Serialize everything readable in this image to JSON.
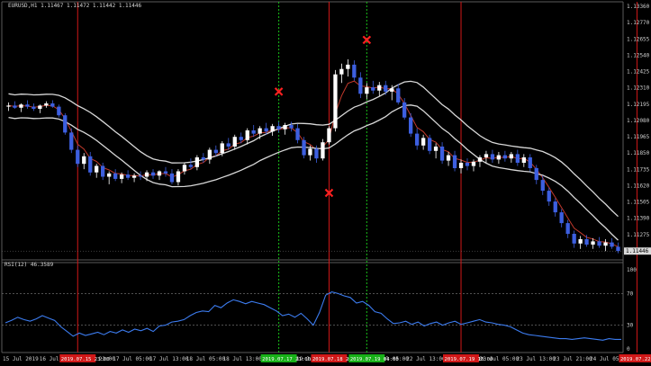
{
  "chart_data": {
    "type": "candlestick",
    "symbol_title": "EURUSD,H1  1.11467 1.11472 1.11442 1.11446",
    "price_axis_labels": [
      "1.13360",
      "1.12770",
      "1.12655",
      "1.12540",
      "1.12425",
      "1.12310",
      "1.12195",
      "1.12080",
      "1.11965",
      "1.11850",
      "1.11735",
      "1.11620",
      "1.11505",
      "1.11390",
      "1.11275",
      "1.11160"
    ],
    "current_price": "1.11446",
    "price_range": [
      1.111,
      1.1337
    ],
    "candles": [
      [
        1.1248,
        1.1252,
        1.1244,
        1.1249
      ],
      [
        1.1249,
        1.1253,
        1.1246,
        1.1247
      ],
      [
        1.1247,
        1.1251,
        1.1243,
        1.125
      ],
      [
        1.125,
        1.1254,
        1.1246,
        1.1248
      ],
      [
        1.1248,
        1.1251,
        1.1244,
        1.1246
      ],
      [
        1.1246,
        1.125,
        1.1242,
        1.1249
      ],
      [
        1.1249,
        1.1253,
        1.1247,
        1.1251
      ],
      [
        1.1251,
        1.1254,
        1.1247,
        1.1248
      ],
      [
        1.1248,
        1.125,
        1.1238,
        1.124
      ],
      [
        1.124,
        1.1242,
        1.1222,
        1.1224
      ],
      [
        1.1224,
        1.1228,
        1.1205,
        1.1208
      ],
      [
        1.1208,
        1.1212,
        1.1192,
        1.1195
      ],
      [
        1.1195,
        1.1205,
        1.119,
        1.1202
      ],
      [
        1.1202,
        1.1206,
        1.1184,
        1.1187
      ],
      [
        1.1187,
        1.1195,
        1.1182,
        1.1193
      ],
      [
        1.1193,
        1.1196,
        1.118,
        1.1183
      ],
      [
        1.1183,
        1.1188,
        1.1176,
        1.1186
      ],
      [
        1.1186,
        1.119,
        1.1179,
        1.1181
      ],
      [
        1.1181,
        1.1187,
        1.1177,
        1.1185
      ],
      [
        1.1185,
        1.1189,
        1.118,
        1.1182
      ],
      [
        1.1182,
        1.1186,
        1.1178,
        1.1184
      ],
      [
        1.1184,
        1.1188,
        1.118,
        1.1183
      ],
      [
        1.1183,
        1.1189,
        1.1179,
        1.1187
      ],
      [
        1.1187,
        1.119,
        1.1181,
        1.1184
      ],
      [
        1.1184,
        1.1189,
        1.118,
        1.1188
      ],
      [
        1.1188,
        1.1192,
        1.1183,
        1.1186
      ],
      [
        1.1186,
        1.119,
        1.1176,
        1.1178
      ],
      [
        1.1178,
        1.119,
        1.1175,
        1.1188
      ],
      [
        1.1188,
        1.1196,
        1.1185,
        1.1194
      ],
      [
        1.1194,
        1.12,
        1.119,
        1.1192
      ],
      [
        1.1192,
        1.1203,
        1.1189,
        1.1201
      ],
      [
        1.1201,
        1.1205,
        1.1196,
        1.1199
      ],
      [
        1.1199,
        1.121,
        1.1195,
        1.1208
      ],
      [
        1.1208,
        1.1212,
        1.1202,
        1.1205
      ],
      [
        1.1205,
        1.1216,
        1.1202,
        1.1214
      ],
      [
        1.1214,
        1.1219,
        1.1208,
        1.1211
      ],
      [
        1.1211,
        1.1222,
        1.1208,
        1.122
      ],
      [
        1.122,
        1.1224,
        1.1214,
        1.1217
      ],
      [
        1.1217,
        1.1228,
        1.1213,
        1.1226
      ],
      [
        1.1226,
        1.1231,
        1.122,
        1.1223
      ],
      [
        1.1223,
        1.123,
        1.1218,
        1.1228
      ],
      [
        1.1228,
        1.1233,
        1.1222,
        1.1225
      ],
      [
        1.1225,
        1.1232,
        1.1221,
        1.123
      ],
      [
        1.123,
        1.1234,
        1.1224,
        1.1227
      ],
      [
        1.1227,
        1.1233,
        1.1222,
        1.1231
      ],
      [
        1.1231,
        1.1234,
        1.1225,
        1.1228
      ],
      [
        1.1228,
        1.1232,
        1.1214,
        1.1217
      ],
      [
        1.1217,
        1.122,
        1.12,
        1.1203
      ],
      [
        1.1203,
        1.1212,
        1.1198,
        1.1209
      ],
      [
        1.1209,
        1.1212,
        1.1196,
        1.12
      ],
      [
        1.12,
        1.1218,
        1.1198,
        1.1215
      ],
      [
        1.1215,
        1.123,
        1.1213,
        1.1228
      ],
      [
        1.1228,
        1.1282,
        1.1225,
        1.1278
      ],
      [
        1.1278,
        1.1288,
        1.127,
        1.1283
      ],
      [
        1.1283,
        1.1292,
        1.1276,
        1.1287
      ],
      [
        1.1287,
        1.1291,
        1.1272,
        1.1275
      ],
      [
        1.1275,
        1.128,
        1.1256,
        1.126
      ],
      [
        1.126,
        1.127,
        1.1255,
        1.1266
      ],
      [
        1.1266,
        1.1272,
        1.126,
        1.1263
      ],
      [
        1.1263,
        1.1271,
        1.1258,
        1.1268
      ],
      [
        1.1268,
        1.1272,
        1.1259,
        1.1262
      ],
      [
        1.1262,
        1.1268,
        1.1254,
        1.1265
      ],
      [
        1.1265,
        1.1269,
        1.125,
        1.1252
      ],
      [
        1.1252,
        1.1256,
        1.1236,
        1.1238
      ],
      [
        1.1238,
        1.1242,
        1.122,
        1.1223
      ],
      [
        1.1223,
        1.1228,
        1.1208,
        1.1212
      ],
      [
        1.1212,
        1.1222,
        1.1208,
        1.1219
      ],
      [
        1.1219,
        1.1222,
        1.1204,
        1.1207
      ],
      [
        1.1207,
        1.1214,
        1.12,
        1.1211
      ],
      [
        1.1211,
        1.1215,
        1.1195,
        1.1198
      ],
      [
        1.1198,
        1.1206,
        1.1193,
        1.1203
      ],
      [
        1.1203,
        1.1207,
        1.1188,
        1.1191
      ],
      [
        1.1191,
        1.1199,
        1.1186,
        1.1196
      ],
      [
        1.1196,
        1.12,
        1.1189,
        1.1193
      ],
      [
        1.1193,
        1.1199,
        1.1188,
        1.1197
      ],
      [
        1.1197,
        1.1203,
        1.1192,
        1.1201
      ],
      [
        1.1201,
        1.1207,
        1.1196,
        1.1204
      ],
      [
        1.1204,
        1.1208,
        1.1196,
        1.1199
      ],
      [
        1.1199,
        1.1206,
        1.1195,
        1.1203
      ],
      [
        1.1203,
        1.1207,
        1.1197,
        1.12
      ],
      [
        1.12,
        1.1206,
        1.1196,
        1.1204
      ],
      [
        1.1204,
        1.1208,
        1.1193,
        1.1196
      ],
      [
        1.1196,
        1.1204,
        1.1192,
        1.1201
      ],
      [
        1.1201,
        1.1204,
        1.1188,
        1.1191
      ],
      [
        1.1191,
        1.1194,
        1.1176,
        1.118
      ],
      [
        1.118,
        1.1184,
        1.1166,
        1.117
      ],
      [
        1.117,
        1.1173,
        1.1156,
        1.116
      ],
      [
        1.116,
        1.1163,
        1.1146,
        1.115
      ],
      [
        1.115,
        1.1153,
        1.1136,
        1.114
      ],
      [
        1.114,
        1.1143,
        1.1126,
        1.113
      ],
      [
        1.113,
        1.1133,
        1.1117,
        1.1121
      ],
      [
        1.1121,
        1.1128,
        1.1116,
        1.1125
      ],
      [
        1.1125,
        1.1129,
        1.1118,
        1.112
      ],
      [
        1.112,
        1.1126,
        1.1116,
        1.1123
      ],
      [
        1.1123,
        1.1127,
        1.1117,
        1.1119
      ],
      [
        1.1119,
        1.1125,
        1.1114,
        1.1122
      ],
      [
        1.1122,
        1.1126,
        1.1116,
        1.1118
      ],
      [
        1.1118,
        1.1122,
        1.1112,
        1.1114
      ]
    ],
    "signal_markers": [
      {
        "candle": 43,
        "price": 1.1262,
        "color": "#ff2020"
      },
      {
        "candle": 51,
        "price": 1.1168,
        "color": "#ff2020"
      },
      {
        "candle": 57,
        "price": 1.131,
        "color": "#ff2020"
      }
    ],
    "vertical_separators": [
      {
        "candle": 11,
        "color": "#d01818",
        "style": "solid"
      },
      {
        "candle": 43,
        "color": "#18c018",
        "style": "dashed"
      },
      {
        "candle": 51,
        "color": "#d01818",
        "style": "solid"
      },
      {
        "candle": 57,
        "color": "#18c018",
        "style": "dashed"
      },
      {
        "candle": 72,
        "color": "#d01818",
        "style": "solid"
      },
      {
        "candle": 100,
        "color": "#d01818",
        "style": "solid"
      }
    ],
    "indicator": {
      "title": "RSI(12) 46.3589",
      "levels": [
        "70",
        "30"
      ],
      "axis_labels": [
        "100",
        "70",
        "30",
        "0"
      ],
      "range": [
        0,
        100
      ],
      "values": [
        33,
        36,
        40,
        37,
        35,
        38,
        42,
        39,
        36,
        28,
        22,
        16,
        20,
        17,
        19,
        21,
        18,
        22,
        20,
        24,
        21,
        25,
        23,
        26,
        22,
        29,
        30,
        34,
        35,
        37,
        42,
        46,
        48,
        47,
        55,
        52,
        58,
        62,
        60,
        57,
        60,
        58,
        56,
        52,
        48,
        42,
        44,
        40,
        45,
        38,
        30,
        46,
        68,
        72,
        70,
        67,
        65,
        58,
        60,
        55,
        47,
        45,
        38,
        32,
        33,
        35,
        31,
        34,
        29,
        32,
        34,
        30,
        33,
        35,
        31,
        33,
        35,
        37,
        34,
        33,
        31,
        30,
        28,
        24,
        20,
        18,
        17,
        16,
        15,
        14,
        13,
        13,
        12,
        13,
        14,
        13,
        12,
        11,
        13,
        12,
        12
      ]
    },
    "time_labels": [
      "15 Jul 2019",
      "16 Jul 13:00",
      "16 Jul 21:00",
      "17 Jul 05:00",
      "17 Jul 13:00",
      "18 Jul 05:00",
      "18 Jul 13:00",
      "18 Jul 21:00",
      "19 Jul 05:00",
      "19 Jul 13:00",
      "22 Jul 05:00",
      "22 Jul 13:00",
      "22 Jul 21:00",
      "23 Jul 05:00",
      "23 Jul 13:00",
      "23 Jul 21:00",
      "24 Jul 05:00"
    ],
    "time_badges": [
      {
        "text": "2019.07.15 23:00",
        "color": "#d01818"
      },
      {
        "text": "2019.07.17 21:00",
        "color": "#18b018"
      },
      {
        "text": "2019.07.18 21:00",
        "color": "#d01818"
      },
      {
        "text": "2019.07.19 04:00",
        "color": "#18b018"
      },
      {
        "text": "2019.07.19 13:00",
        "color": "#d01818"
      },
      {
        "text": "2019.07.22 14:00",
        "color": "#d01818"
      }
    ],
    "colors": {
      "bull": "#ffffff",
      "bear": "#3d5fe0",
      "rsi": "#3c7cf0",
      "band": "#d8d8d8",
      "ma": "#c0392b"
    }
  }
}
